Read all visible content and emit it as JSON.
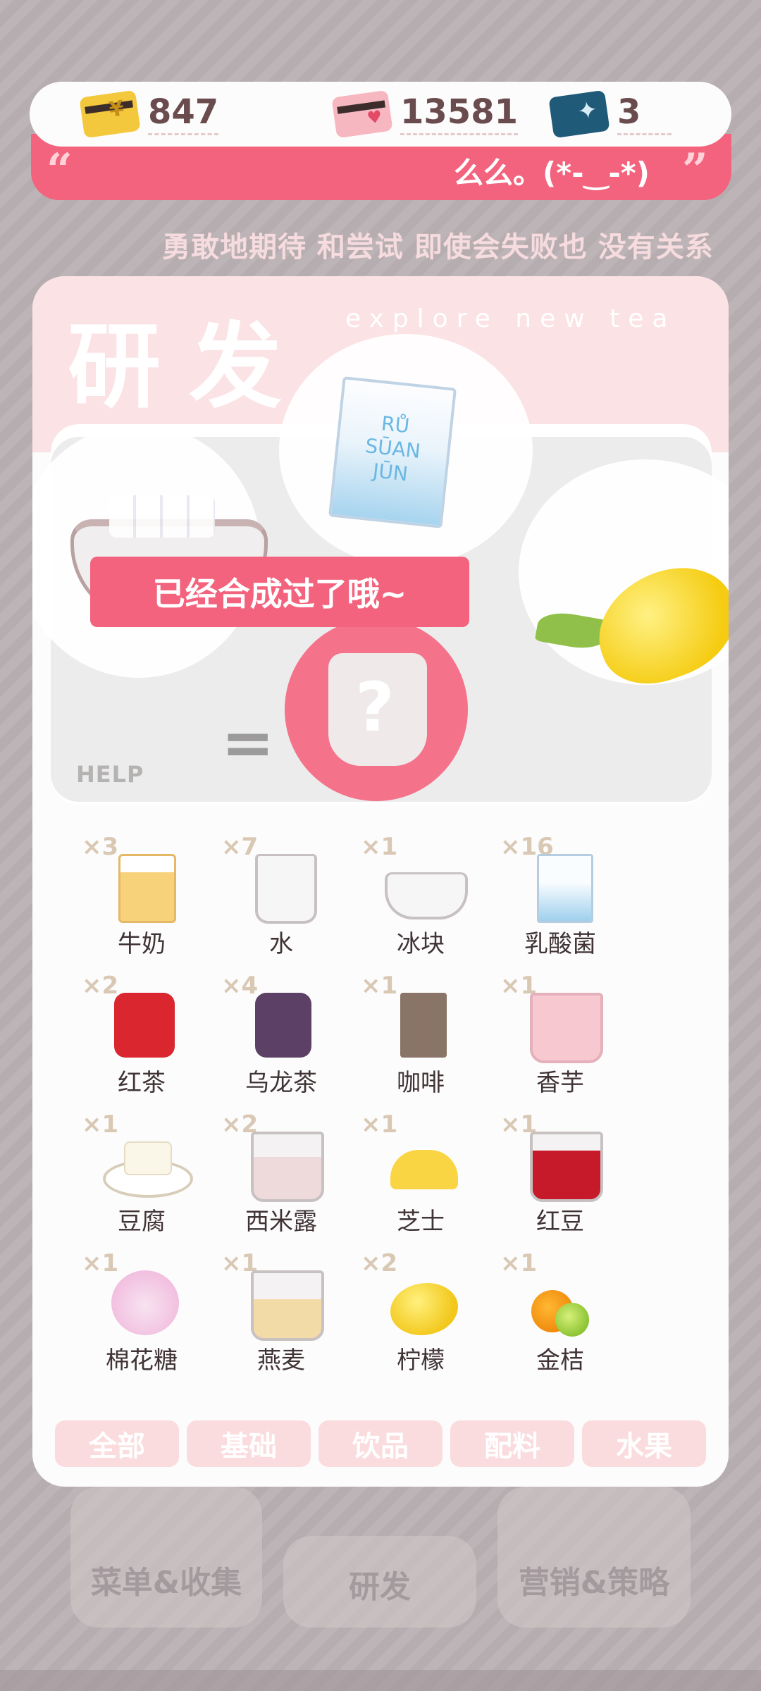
{
  "currencies": [
    {
      "icon": "gold-card-icon",
      "value": "847"
    },
    {
      "icon": "heart-card-icon",
      "value": "13581"
    },
    {
      "icon": "ticket-card-icon",
      "value": "3"
    }
  ],
  "banner": {
    "open_quote": "“",
    "text": "么么。(*-‿-*)",
    "close_quote": "”"
  },
  "motto": "勇敢地期待 和尝试   即使会失败也 没有关系",
  "research": {
    "title": "研发",
    "subtitle": "explore new tea",
    "help_label": "HELP",
    "equals": "=",
    "result_symbol": "?",
    "toast": "已经合成过了哦~",
    "carton_text": "RŮ\nSŪAN\nJŪN"
  },
  "ingredients": [
    {
      "count": "×3",
      "name": "牛奶",
      "icon": "milk-carton-icon"
    },
    {
      "count": "×7",
      "name": "水",
      "icon": "water-glass-icon"
    },
    {
      "count": "×1",
      "name": "冰块",
      "icon": "ice-bowl-icon"
    },
    {
      "count": "×16",
      "name": "乳酸菌",
      "icon": "lactobacillus-carton-icon"
    },
    {
      "count": "×2",
      "name": "红茶",
      "icon": "black-tea-tin-icon"
    },
    {
      "count": "×4",
      "name": "乌龙茶",
      "icon": "oolong-tea-tin-icon"
    },
    {
      "count": "×1",
      "name": "咖啡",
      "icon": "coffee-bag-icon"
    },
    {
      "count": "×1",
      "name": "香芋",
      "icon": "taro-glass-icon"
    },
    {
      "count": "×1",
      "name": "豆腐",
      "icon": "tofu-plate-icon"
    },
    {
      "count": "×2",
      "name": "西米露",
      "icon": "sago-glass-icon"
    },
    {
      "count": "×1",
      "name": "芝士",
      "icon": "cheese-plate-icon"
    },
    {
      "count": "×1",
      "name": "红豆",
      "icon": "red-bean-glass-icon"
    },
    {
      "count": "×1",
      "name": "棉花糖",
      "icon": "marshmallow-bag-icon"
    },
    {
      "count": "×1",
      "name": "燕麦",
      "icon": "oat-glass-icon"
    },
    {
      "count": "×2",
      "name": "柠檬",
      "icon": "lemon-icon"
    },
    {
      "count": "×1",
      "name": "金桔",
      "icon": "kumquat-icon"
    }
  ],
  "tabs": [
    "全部",
    "基础",
    "饮品",
    "配料",
    "水果"
  ],
  "background_buttons": [
    "菜单&收集",
    "研发",
    "营销&策略"
  ],
  "colors": {
    "accent_pink": "#f3637d",
    "panel_pink": "#fbe2e5",
    "tab_pink": "#fbdcde",
    "text_dark": "#3f3335"
  }
}
